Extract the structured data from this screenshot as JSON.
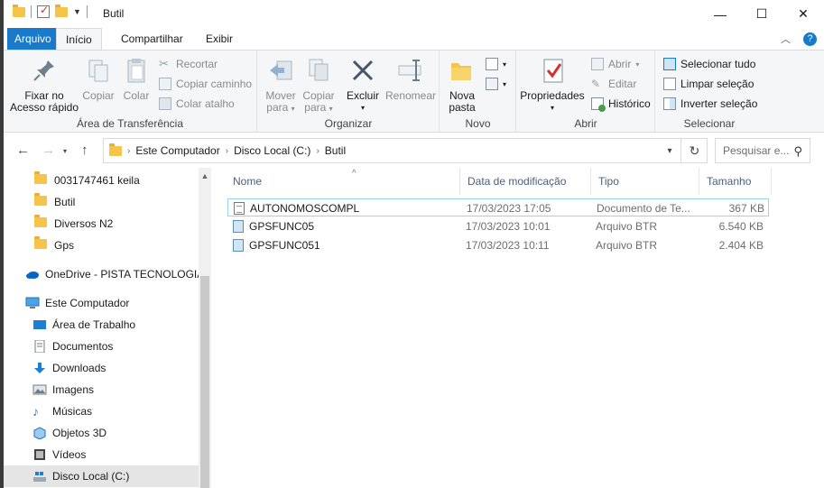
{
  "window": {
    "title": "Butil",
    "controls": {
      "minimize": "—",
      "maximize": "☐",
      "close": "✕"
    }
  },
  "ribbon_tabs": {
    "file": "Arquivo",
    "home": "Início",
    "share": "Compartilhar",
    "view": "Exibir"
  },
  "ribbon": {
    "clipboard": {
      "label": "Área de Transferência",
      "pin": "Fixar no\nAcesso rápido",
      "pin_l1": "Fixar no",
      "pin_l2": "Acesso rápido",
      "copy": "Copiar",
      "paste": "Colar",
      "cut": "Recortar",
      "copy_path": "Copiar caminho",
      "paste_shortcut": "Colar atalho"
    },
    "organize": {
      "label": "Organizar",
      "move_l1": "Mover",
      "move_l2": "para",
      "copy_l1": "Copiar",
      "copy_l2": "para",
      "delete": "Excluir",
      "rename": "Renomear"
    },
    "new": {
      "label": "Novo",
      "folder_l1": "Nova",
      "folder_l2": "pasta"
    },
    "open": {
      "label": "Abrir",
      "properties": "Propriedades",
      "open": "Abrir",
      "edit": "Editar",
      "history": "Histórico"
    },
    "select": {
      "label": "Selecionar",
      "select_all": "Selecionar tudo",
      "select_none": "Limpar seleção",
      "invert": "Inverter seleção"
    }
  },
  "address": {
    "crumbs": [
      "Este Computador",
      "Disco Local (C:)",
      "Butil"
    ],
    "search_placeholder": "Pesquisar e..."
  },
  "navpane": {
    "items": [
      {
        "label": "0031747461 keila",
        "icon": "folder-icon"
      },
      {
        "label": "Butil",
        "icon": "folder-icon"
      },
      {
        "label": "Diversos N2",
        "icon": "folder-icon"
      },
      {
        "label": "Gps",
        "icon": "folder-icon"
      },
      {
        "label": "OneDrive - PISTA TECNOLOGIA",
        "icon": "cloud-icon"
      },
      {
        "label": "Este Computador",
        "icon": "computer-icon"
      },
      {
        "label": "Área de Trabalho",
        "icon": "desktop-icon"
      },
      {
        "label": "Documentos",
        "icon": "documents-icon"
      },
      {
        "label": "Downloads",
        "icon": "download-icon"
      },
      {
        "label": "Imagens",
        "icon": "pictures-icon"
      },
      {
        "label": "Músicas",
        "icon": "music-icon"
      },
      {
        "label": "Objetos 3D",
        "icon": "cube-icon"
      },
      {
        "label": "Vídeos",
        "icon": "video-icon"
      },
      {
        "label": "Disco Local (C:)",
        "icon": "drive-icon"
      }
    ]
  },
  "filelist": {
    "headers": {
      "name": "Nome",
      "date": "Data de modificação",
      "type": "Tipo",
      "size": "Tamanho"
    },
    "rows": [
      {
        "name": "AUTONOMOSCOMPL",
        "date": "17/03/2023 17:05",
        "type": "Documento de Te...",
        "size": "367 KB",
        "icon": "text-document-icon"
      },
      {
        "name": "GPSFUNC05",
        "date": "17/03/2023 10:01",
        "type": "Arquivo BTR",
        "size": "6.540 KB",
        "icon": "btr-file-icon"
      },
      {
        "name": "GPSFUNC051",
        "date": "17/03/2023 10:11",
        "type": "Arquivo BTR",
        "size": "2.404 KB",
        "icon": "btr-file-icon"
      }
    ]
  }
}
